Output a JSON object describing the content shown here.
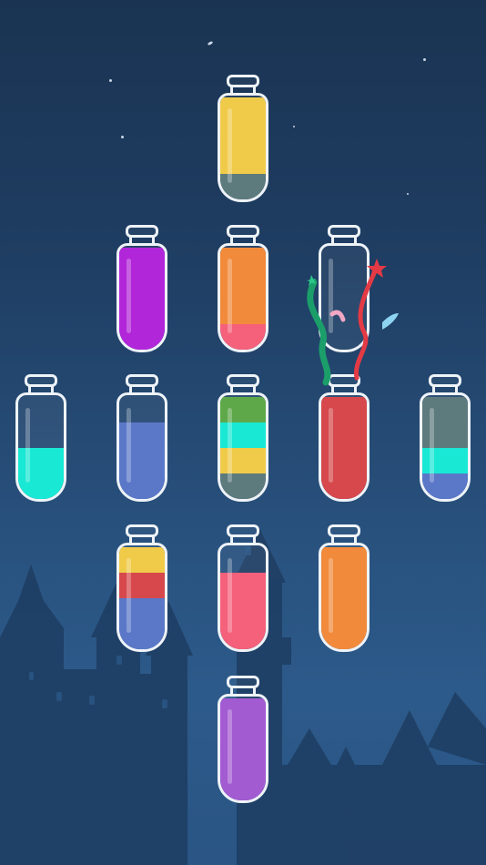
{
  "game": {
    "layer_height_fraction": 0.25,
    "bottles": [
      {
        "id": "b1",
        "layers": [
          "#5d7a7d",
          "#f0cb4a",
          "#f0cb4a",
          "#f0cb4a"
        ]
      },
      {
        "id": "b2",
        "layers": [
          "#b226d9",
          "#b226d9",
          "#b226d9",
          "#b226d9"
        ]
      },
      {
        "id": "b3",
        "layers": [
          "#f5607a",
          "#f28a3b",
          "#f28a3b",
          "#f28a3b"
        ]
      },
      {
        "id": "b4",
        "layers": []
      },
      {
        "id": "b5",
        "layers": [
          "#19e8d4",
          "#19e8d4"
        ]
      },
      {
        "id": "b6",
        "layers": [
          "#5b78c8",
          "#5b78c8",
          "#5b78c8"
        ]
      },
      {
        "id": "b7",
        "layers": [
          "#5d7a7d",
          "#f0cb4a",
          "#19e8d4",
          "#5ea84a"
        ]
      },
      {
        "id": "b8",
        "layers": [
          "#d6484c",
          "#d6484c",
          "#d6484c",
          "#d6484c"
        ]
      },
      {
        "id": "b9",
        "layers": [
          "#5b78c8",
          "#19e8d4",
          "#5d7a7d",
          "#5d7a7d"
        ]
      },
      {
        "id": "b10",
        "layers": [
          "#5b78c8",
          "#5b78c8",
          "#d6484c",
          "#f0cb4a"
        ]
      },
      {
        "id": "b11",
        "layers": [
          "#f5607a",
          "#f5607a",
          "#f5607a"
        ]
      },
      {
        "id": "b12",
        "layers": [
          "#f28a3b",
          "#f28a3b",
          "#f28a3b",
          "#f28a3b"
        ]
      },
      {
        "id": "b13",
        "layers": [
          "#a35bd1",
          "#a35bd1",
          "#a35bd1",
          "#a35bd1"
        ]
      }
    ]
  },
  "colors": {
    "bottle_outline": "#eef3f8",
    "sky_top": "#1a3352",
    "sky_bottom": "#2c5a8a",
    "castle": "#1e3d62"
  },
  "effects": {
    "celebration_over_bottle": "b4"
  }
}
